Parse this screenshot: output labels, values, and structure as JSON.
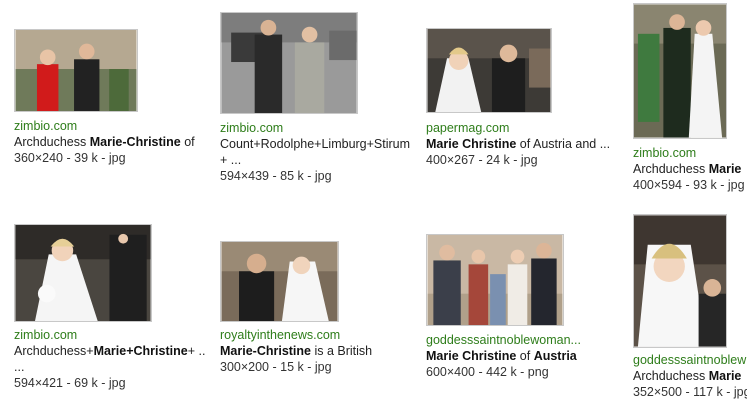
{
  "results": [
    {
      "domain": "zimbio.com",
      "title_pre": "Archduchess ",
      "title_bold": "Marie-Christine",
      "title_post": " of",
      "title_line2": "",
      "dims": "360×240 - 39 k - jpg"
    },
    {
      "domain": "zimbio.com",
      "title_pre": "Count+Rodolphe+Limburg+Stirum",
      "title_bold": "",
      "title_post": "",
      "title_line2": "+ ...",
      "dims": "594×439 - 85 k - jpg"
    },
    {
      "domain": "papermag.com",
      "title_pre": "",
      "title_bold": "Marie Christine",
      "title_post": " of Austria and ...",
      "title_line2": "",
      "dims": "400×267 - 24 k - jpg"
    },
    {
      "domain": "zimbio.com",
      "title_pre": "Archduchess ",
      "title_bold": "Marie",
      "title_post": "",
      "title_line2": "",
      "dims": "400×594 - 93 k - jpg"
    },
    {
      "domain": "zimbio.com",
      "title_pre": "Archduchess+",
      "title_bold": "Marie+Christine",
      "title_post": "+ ..",
      "title_line2": "...",
      "dims": "594×421 - 69 k - jpg"
    },
    {
      "domain": "royaltyinthenews.com",
      "title_pre": "",
      "title_bold": "Marie-Christine",
      "title_post": " is a British",
      "title_line2": "",
      "dims": "300×200 - 15 k - jpg"
    },
    {
      "domain": "goddesssaintnoblewoman...",
      "title_pre": "",
      "title_bold": "Marie Christine",
      "title_post": " of ",
      "title_bold2": "Austria",
      "title_line2": "",
      "dims": "600×400 - 442 k - png"
    },
    {
      "domain": "goddesssaintnoblew",
      "title_pre": "Archduchess ",
      "title_bold": "Marie",
      "title_post": "",
      "title_line2": "",
      "dims": "352×500 - 117 k - jpg"
    }
  ]
}
